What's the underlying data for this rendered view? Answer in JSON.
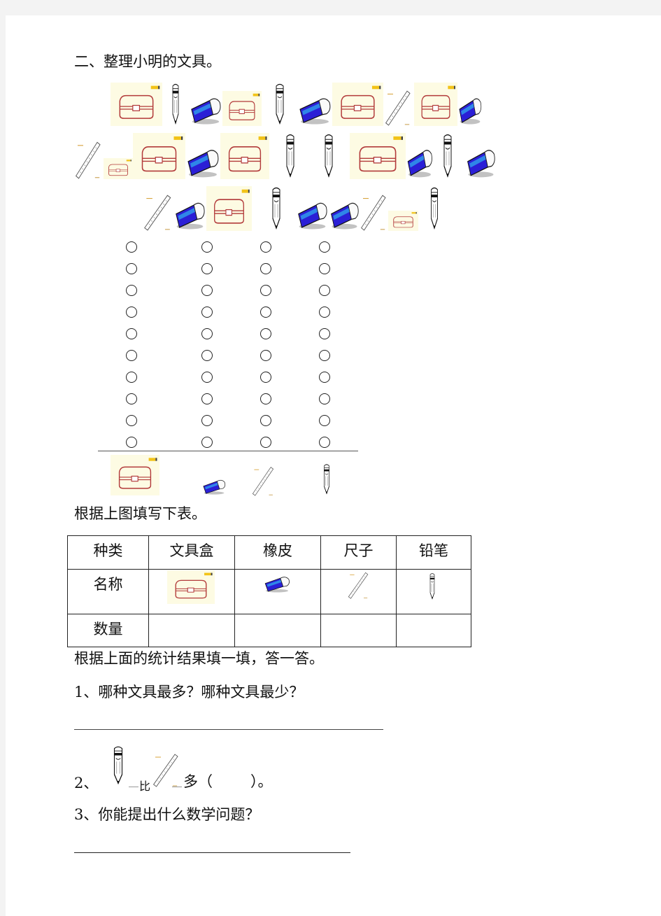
{
  "section_title": "二、整理小明的文具。",
  "colors": {
    "box_bg": "#fdfbe3",
    "box_line": "#b23a3a",
    "eraser_blue": "#2b1fd6",
    "eraser_stripe": "#2f86e8",
    "page_bg": "#f3f3f3"
  },
  "stationery_rows": [
    [
      "pencil-box",
      "pencil",
      "eraser",
      "pencil-box",
      "pencil",
      "eraser",
      "pencil-box",
      "ruler",
      "pencil-box",
      "eraser"
    ],
    [
      "ruler",
      "pencil-box",
      "pencil-box",
      "eraser",
      "pencil-box",
      "pencil",
      "pencil",
      "pencil-box",
      "eraser",
      "pencil",
      "eraser"
    ],
    [
      "ruler",
      "eraser",
      "pencil-box",
      "pencil",
      "eraser",
      "eraser",
      "ruler",
      "pencil-box",
      "pencil"
    ]
  ],
  "tally_chart": {
    "rows_per_column": 10,
    "columns": [
      "pencil-box",
      "eraser",
      "ruler",
      "pencil"
    ],
    "filled": [
      0,
      0,
      0,
      0
    ]
  },
  "table_instruction": "根据上图填写下表。",
  "table": {
    "header": [
      "种类",
      "文具盒",
      "橡皮",
      "尺子",
      "铅笔"
    ],
    "name_row_label": "名称",
    "name_row_icons": [
      "pencil-box",
      "eraser",
      "ruler",
      "pencil"
    ],
    "count_row_label": "数量",
    "count_row_values": [
      "",
      "",
      "",
      ""
    ]
  },
  "questions_intro": "根据上面的统计结果填一填，答一答。",
  "questions": {
    "q1": "1、哪种文具最多？哪种文具最少？",
    "q2_prefix": "2、",
    "q2_compare": "比",
    "q2_more": "多（",
    "q2_close": "）。",
    "q3": "3、你能提出什么数学问题？"
  }
}
